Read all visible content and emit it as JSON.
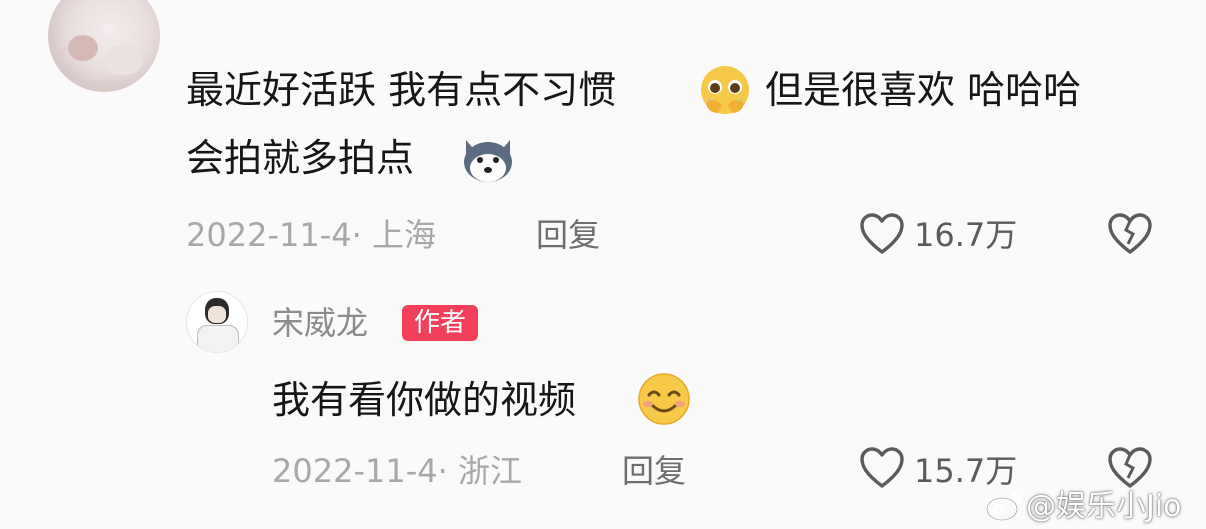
{
  "comment": {
    "line1": "最近好活跃 我有点不习惯",
    "line1_cont": "但是很喜欢 哈哈哈",
    "line2": "会拍就多拍点",
    "emoji1": "pleading-face-emoji",
    "emoji2": "husky-dog-emoji",
    "meta": "2022-11-4· 上海",
    "reply_label": "回复",
    "like_count": "16.7万"
  },
  "reply": {
    "username": "宋威龙",
    "badge": "作者",
    "text": "我有看你做的视频",
    "emoji": "smiling-face-emoji",
    "meta": "2022-11-4· 浙江",
    "reply_label": "回复",
    "like_count": "15.7万"
  },
  "watermark": {
    "text": "@娱乐小Jio"
  },
  "colors": {
    "accent": "#f23f5a",
    "meta_gray": "#a8a8a8",
    "background": "#fafafa"
  }
}
